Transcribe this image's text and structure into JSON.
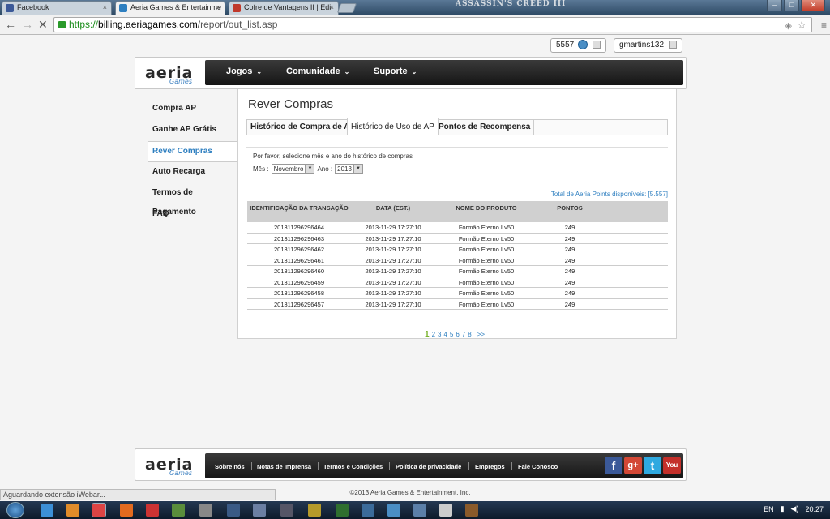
{
  "browser": {
    "tabs": [
      {
        "label": "Facebook",
        "color": "#3b5998"
      },
      {
        "label": "Aeria Games & Entertainme",
        "color": "#2e7fc0"
      },
      {
        "label": "Cofre de Vantagens II | Edi",
        "color": "#c0392b"
      }
    ],
    "banner": "ASSASSIN'S CREED III",
    "url_scheme": "https://",
    "url_host": "billing.aeriagames.com",
    "url_path": "/report/out_list.asp"
  },
  "userbar": {
    "points": "5557",
    "username": "gmartins132"
  },
  "header": {
    "logo": "aeria",
    "logo_sub": "Games",
    "nav": [
      "Jogos",
      "Comunidade",
      "Suporte"
    ],
    "chevron": "⌄"
  },
  "sidebar": {
    "items": [
      "Compra AP",
      "Ganhe AP Grátis",
      "Rever Compras",
      "Auto Recarga",
      "Termos de Pagamento",
      "FAQ"
    ],
    "active_index": 2
  },
  "main": {
    "title": "Rever Compras",
    "tabs": [
      "Histórico de Compra de AP",
      "Histórico de Uso de AP",
      "Pontos de Recompensa"
    ],
    "active_tab": 1,
    "instruction": "Por favor, selecione mês e ano do histórico de compras",
    "month_label": "Mês :",
    "month_value": "Novembro",
    "year_label": "Ano :",
    "year_value": "2013",
    "total_text": "Total de Aeria Points disponíveis: [5.557]",
    "table": {
      "headers": [
        "IDENTIFICAÇÃO DA TRANSAÇÃO",
        "DATA (EST.)",
        "NOME DO PRODUTO",
        "PONTOS"
      ],
      "rows": [
        [
          "201311296296464",
          "2013-11-29 17:27:10",
          "Formão Eterno Lv50",
          "249"
        ],
        [
          "201311296296463",
          "2013-11-29 17:27:10",
          "Formão Eterno Lv50",
          "249"
        ],
        [
          "201311296296462",
          "2013-11-29 17:27:10",
          "Formão Eterno Lv50",
          "249"
        ],
        [
          "201311296296461",
          "2013-11-29 17:27:10",
          "Formão Eterno Lv50",
          "249"
        ],
        [
          "201311296296460",
          "2013-11-29 17:27:10",
          "Formão Eterno Lv50",
          "249"
        ],
        [
          "201311296296459",
          "2013-11-29 17:27:10",
          "Formão Eterno Lv50",
          "249"
        ],
        [
          "201311296296458",
          "2013-11-29 17:27:10",
          "Formão Eterno Lv50",
          "249"
        ],
        [
          "201311296296457",
          "2013-11-29 17:27:10",
          "Formão Eterno Lv50",
          "249"
        ]
      ]
    },
    "pager": {
      "current": "1",
      "pages": [
        "2",
        "3",
        "4",
        "5",
        "6",
        "7",
        "8"
      ],
      "next": ">>"
    }
  },
  "footer": {
    "links": [
      "Sobre nós",
      "Notas de Imprensa",
      "Termos e Condições",
      "Política de privacidade",
      "Empregos",
      "Fale Conosco"
    ],
    "social": [
      {
        "label": "f",
        "color": "#3b5998"
      },
      {
        "label": "g+",
        "color": "#d34836"
      },
      {
        "label": "t",
        "color": "#2fa9e0"
      },
      {
        "label": "You",
        "color": "#c4302b"
      }
    ],
    "copyright": "©2013 Aeria Games & Entertainment, Inc."
  },
  "statusbar": "Aguardando extensão iWebar...",
  "taskbar": {
    "lang": "EN",
    "clock": "20:27"
  }
}
